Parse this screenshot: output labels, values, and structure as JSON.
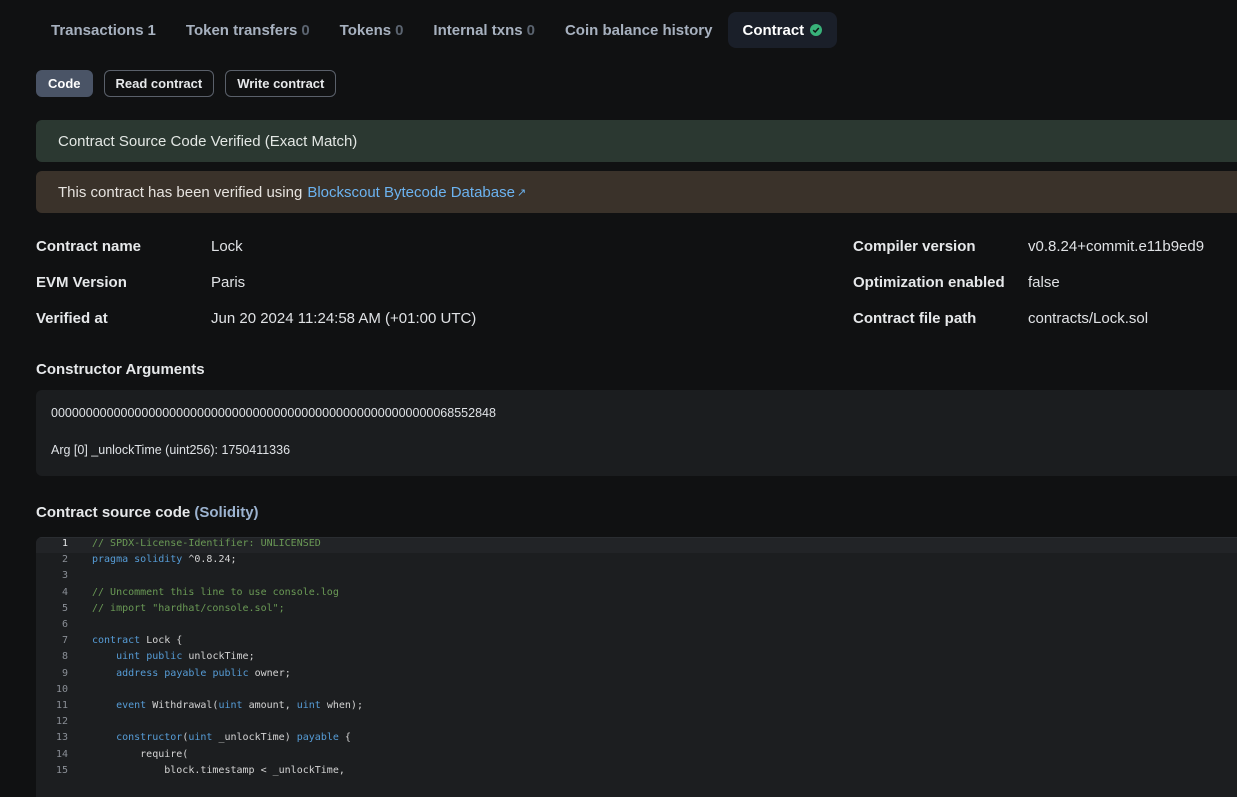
{
  "tabs": [
    {
      "label": "Transactions",
      "count": "1",
      "active": false
    },
    {
      "label": "Token transfers",
      "count": "0",
      "active": false
    },
    {
      "label": "Tokens",
      "count": "0",
      "active": false
    },
    {
      "label": "Internal txns",
      "count": "0",
      "active": false
    },
    {
      "label": "Coin balance history",
      "count": "",
      "active": false
    },
    {
      "label": "Contract",
      "count": "",
      "active": true
    }
  ],
  "subtabs": {
    "code": "Code",
    "read": "Read contract",
    "write": "Write contract"
  },
  "alerts": {
    "verified": "Contract Source Code Verified (Exact Match)",
    "db_prefix": "This contract has been verified using",
    "db_link": "Blockscout Bytecode Database"
  },
  "info": {
    "contract_name_label": "Contract name",
    "contract_name": "Lock",
    "evm_label": "EVM Version",
    "evm": "Paris",
    "verified_label": "Verified at",
    "verified": "Jun 20 2024 11:24:58 AM (+01:00 UTC)",
    "compiler_label": "Compiler version",
    "compiler": "v0.8.24+commit.e11b9ed9",
    "optimization_label": "Optimization enabled",
    "optimization": "false",
    "filepath_label": "Contract file path",
    "filepath": "contracts/Lock.sol"
  },
  "constructor": {
    "title": "Constructor Arguments",
    "hex": "0000000000000000000000000000000000000000000000000000000068552848",
    "arg": "Arg [0] _unlockTime (uint256): 1750411336"
  },
  "source": {
    "title": "Contract source code",
    "lang": "(Solidity)",
    "lines": [
      {
        "n": "1",
        "text": "// SPDX-License-Identifier: UNLICENSED"
      },
      {
        "n": "2",
        "text": "pragma solidity ^0.8.24;"
      },
      {
        "n": "3",
        "text": ""
      },
      {
        "n": "4",
        "text": "// Uncomment this line to use console.log"
      },
      {
        "n": "5",
        "text": "// import \"hardhat/console.sol\";"
      },
      {
        "n": "6",
        "text": ""
      },
      {
        "n": "7",
        "text": "contract Lock {"
      },
      {
        "n": "8",
        "text": "    uint public unlockTime;"
      },
      {
        "n": "9",
        "text": "    address payable public owner;"
      },
      {
        "n": "10",
        "text": ""
      },
      {
        "n": "11",
        "text": "    event Withdrawal(uint amount, uint when);"
      },
      {
        "n": "12",
        "text": ""
      },
      {
        "n": "13",
        "text": "    constructor(uint _unlockTime) payable {"
      },
      {
        "n": "14",
        "text": "        require("
      },
      {
        "n": "15",
        "text": "            block.timestamp < _unlockTime,"
      }
    ]
  },
  "colors": {
    "accent": "#6cb3f0",
    "success": "#38b27a",
    "keyword": "#569cd6",
    "comment": "#6a9955"
  },
  "icons": {
    "verified": "check-circle-icon",
    "external": "external-link-icon"
  }
}
